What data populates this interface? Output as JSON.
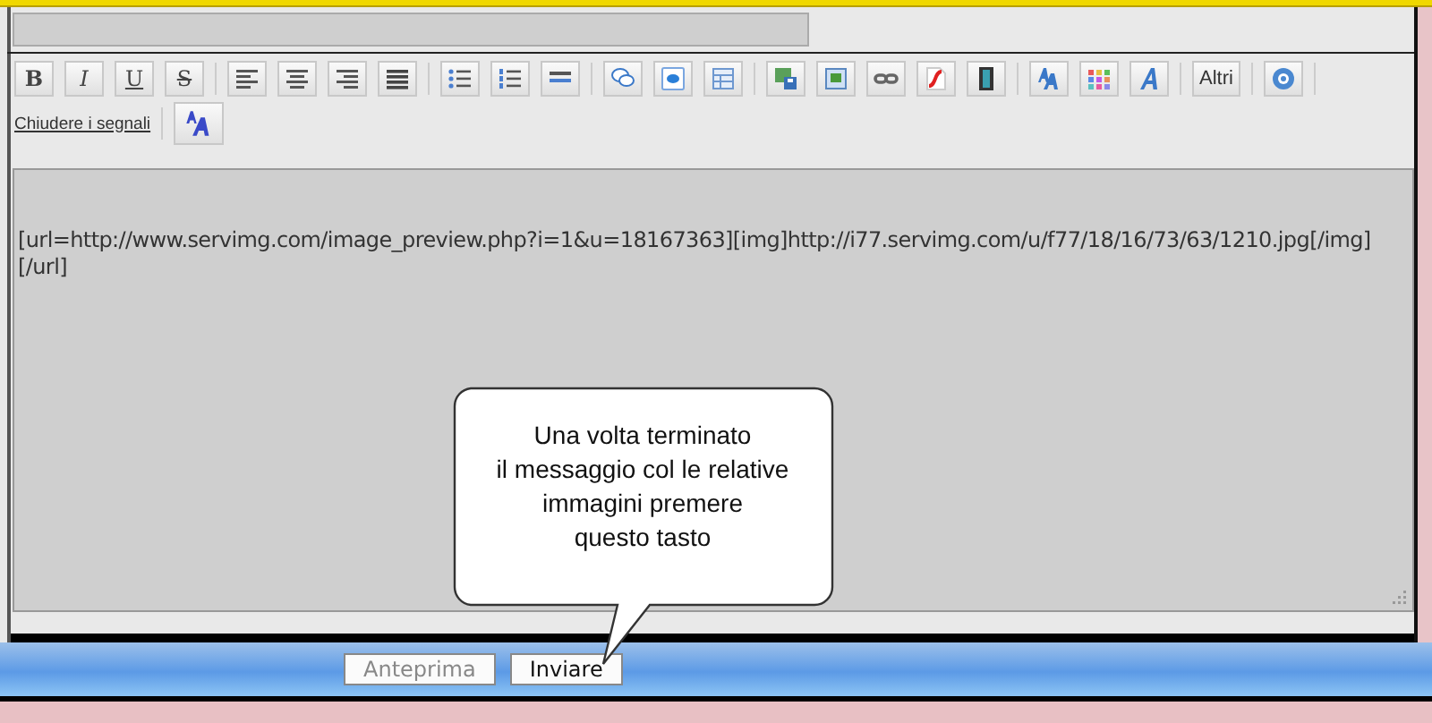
{
  "toolbar": {
    "groups": [
      [
        {
          "kind": "bold",
          "label": "B"
        },
        {
          "kind": "italic",
          "label": "I"
        },
        {
          "kind": "underline",
          "label": "U"
        },
        {
          "kind": "strike",
          "label": "S"
        }
      ],
      [
        {
          "kind": "align-left"
        },
        {
          "kind": "align-center"
        },
        {
          "kind": "align-right"
        },
        {
          "kind": "justify"
        }
      ],
      [
        {
          "kind": "bullet-list"
        },
        {
          "kind": "numbered-list"
        },
        {
          "kind": "rule"
        }
      ],
      [
        {
          "kind": "speech"
        },
        {
          "kind": "code"
        },
        {
          "kind": "table"
        }
      ],
      [
        {
          "kind": "image-save"
        },
        {
          "kind": "image"
        },
        {
          "kind": "link"
        },
        {
          "kind": "flash"
        },
        {
          "kind": "film"
        }
      ],
      [
        {
          "kind": "font-size"
        },
        {
          "kind": "color-grid"
        },
        {
          "kind": "font"
        }
      ],
      [
        {
          "kind": "more",
          "label": "Altri"
        }
      ],
      [
        {
          "kind": "help"
        }
      ]
    ]
  },
  "toggle_link": "Chiudere i segnali",
  "message_text": "[url=http://www.servimg.com/image_preview.php?i=1&u=18167363][img]http://i77.servimg.com/u/f77/18/16/73/63/1210.jpg[/img][/url]",
  "callout": "Una volta terminato\nil messaggio col le relative\nimmagini premere\nquesto tasto",
  "buttons": [
    {
      "label": "Anteprima",
      "disabled": true
    },
    {
      "label": "Inviare",
      "disabled": false
    }
  ]
}
